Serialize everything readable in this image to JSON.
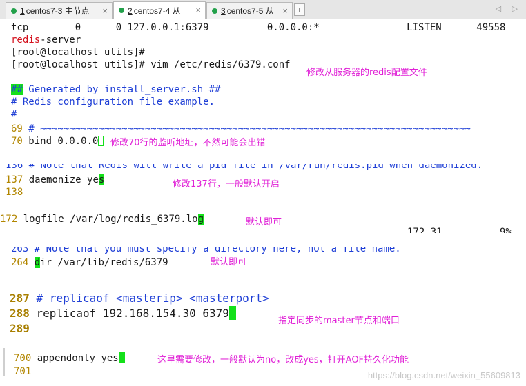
{
  "tabs": [
    {
      "num": "1",
      "label": "centos7-3 主节点",
      "active": false
    },
    {
      "num": "2",
      "label": "centos7-4 从",
      "active": true
    },
    {
      "num": "3",
      "label": "centos7-5 从",
      "active": false
    }
  ],
  "tab_close": "×",
  "add_tab": "+",
  "nav_arrows": "◁ ▷",
  "terminal": {
    "netstat_line": "tcp        0      0 127.0.0.1:6379          0.0.0.0:*               LISTEN      49558",
    "redis_server_prefix": "redis",
    "redis_server_suffix": "-server",
    "prompt1": "[root@localhost utils]#",
    "prompt2": "[root@localhost utils]# vim /etc/redis/6379.conf",
    "gen_hash": "##",
    "gen_text": " Generated by install_server.sh ##",
    "example": "# Redis configuration file example.",
    "hash": "#"
  },
  "vim": {
    "l69_num": "69",
    "l69_text": " # ~~~~~~~~~~~~~~~~~~~~~~~~~~~~~~~~~~~~~~~~~~~~~~~~~~~~~~~~~~~~~~~~~~~~~~~~~~",
    "l70_num": "70",
    "l70_text": " bind 0.0.0.0",
    "l136_text": "136 # Note that Redis will write a pid file in /var/run/redis.pid when daemonized.",
    "l137_num": "137",
    "l137_text": " daemonize ye",
    "l137_cursor": "s",
    "l138_num": "138",
    "l172_num": "172",
    "l172_text": " logfile /var/log/redis_6379.lo",
    "l172_cursor": "g",
    "status_pos": "172,31",
    "status_pct": "9%",
    "l263_text": "263 # Note that you must specify a directory here, not a file name.",
    "l264_num": "264",
    "l264_cursor": "d",
    "l264_text": "ir /var/lib/redis/6379",
    "l287_num": "287",
    "l287_text": " # replicaof <masterip> <masterport>",
    "l288_num": "288",
    "l288_text": " replicaof 192.168.154.30 6379",
    "l289_num": "289",
    "l700_num": "700",
    "l700_text": " appendonly yes",
    "l701_num": "701"
  },
  "annotations": {
    "a1": "修改从服务器的redis配置文件",
    "a2": "修改70行的监听地址，不然可能会出错",
    "a3": "修改137行，一般默认开启",
    "a4": "默认即可",
    "a5": "默认即可",
    "a6": "指定同步的master节点和端口",
    "a7": "这里需要修改，一般默认为no，改成yes，打开AOF持久化功能"
  },
  "watermark": "https://blog.csdn.net/weixin_55609813",
  "colors": {
    "annotation": "#e020d6",
    "cursor": "#14e01a",
    "line_number": "#b28600",
    "comment": "#1f3fd6"
  }
}
